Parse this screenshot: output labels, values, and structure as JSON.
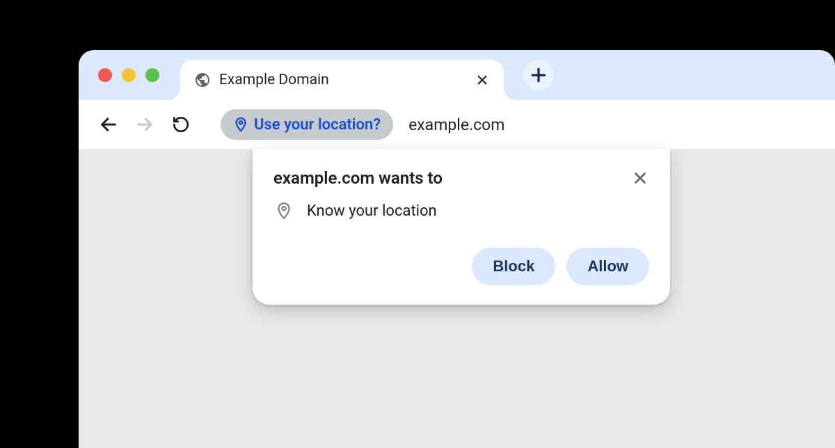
{
  "tab": {
    "title": "Example Domain"
  },
  "address": {
    "chip_text": "Use your location?",
    "url": "example.com"
  },
  "dialog": {
    "title": "example.com wants to",
    "permission_text": "Know your location",
    "block_label": "Block",
    "allow_label": "Allow"
  }
}
